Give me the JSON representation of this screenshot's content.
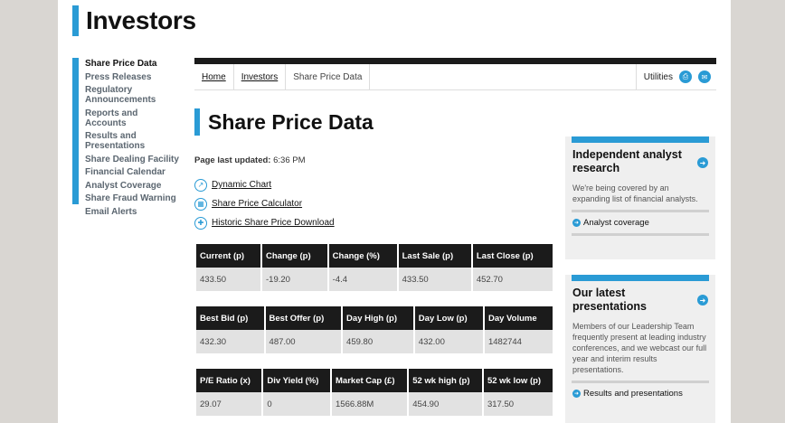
{
  "site": {
    "title": "Investors"
  },
  "sidebar": {
    "items": [
      {
        "label": "Share Price Data",
        "active": true
      },
      {
        "label": "Press Releases"
      },
      {
        "label": "Regulatory Announcements"
      },
      {
        "label": "Reports and Accounts"
      },
      {
        "label": "Results and Presentations"
      },
      {
        "label": "Share Dealing Facility"
      },
      {
        "label": "Financial Calendar"
      },
      {
        "label": "Analyst Coverage"
      },
      {
        "label": "Share Fraud Warning"
      },
      {
        "label": "Email Alerts"
      }
    ]
  },
  "breadcrumb": {
    "home": "Home",
    "investors": "Investors",
    "current": "Share Price Data"
  },
  "utilities": {
    "label": "Utilities"
  },
  "main": {
    "title": "Share Price Data",
    "updated_label": "Page last updated:",
    "updated_value": "6:36 PM",
    "links": {
      "dynamic_chart": "Dynamic Chart",
      "calculator": "Share Price Calculator",
      "download": "Historic Share Price Download"
    }
  },
  "tables": [
    {
      "headers": [
        "Current (p)",
        "Change (p)",
        "Change (%)",
        "Last Sale (p)",
        "Last Close (p)"
      ],
      "values": [
        "433.50",
        "-19.20",
        "-4.4",
        "433.50",
        "452.70"
      ]
    },
    {
      "headers": [
        "Best Bid (p)",
        "Best Offer (p)",
        "Day High (p)",
        "Day Low (p)",
        "Day Volume"
      ],
      "values": [
        "432.30",
        "487.00",
        "459.80",
        "432.00",
        "1482744"
      ]
    },
    {
      "headers": [
        "P/E Ratio (x)",
        "Div Yield (%)",
        "Market Cap (£)",
        "52 wk high (p)",
        "52 wk low (p)"
      ],
      "values": [
        "29.07",
        "0",
        "1566.88M",
        "454.90",
        "317.50"
      ]
    }
  ],
  "cards": {
    "analyst": {
      "title": "Independent analyst research",
      "body": "We're being covered by an expanding list of financial analysts.",
      "link": "Analyst coverage"
    },
    "presentations": {
      "title": "Our latest presentations",
      "body": "Members of our Leadership Team frequently present at leading industry conferences, and we webcast our full year and interim results presentations.",
      "link": "Results and presentations"
    }
  },
  "colors": {
    "accent": "#2a9bd5",
    "header_dark": "#1b1b1b",
    "cell_bg": "#e2e2e2"
  }
}
